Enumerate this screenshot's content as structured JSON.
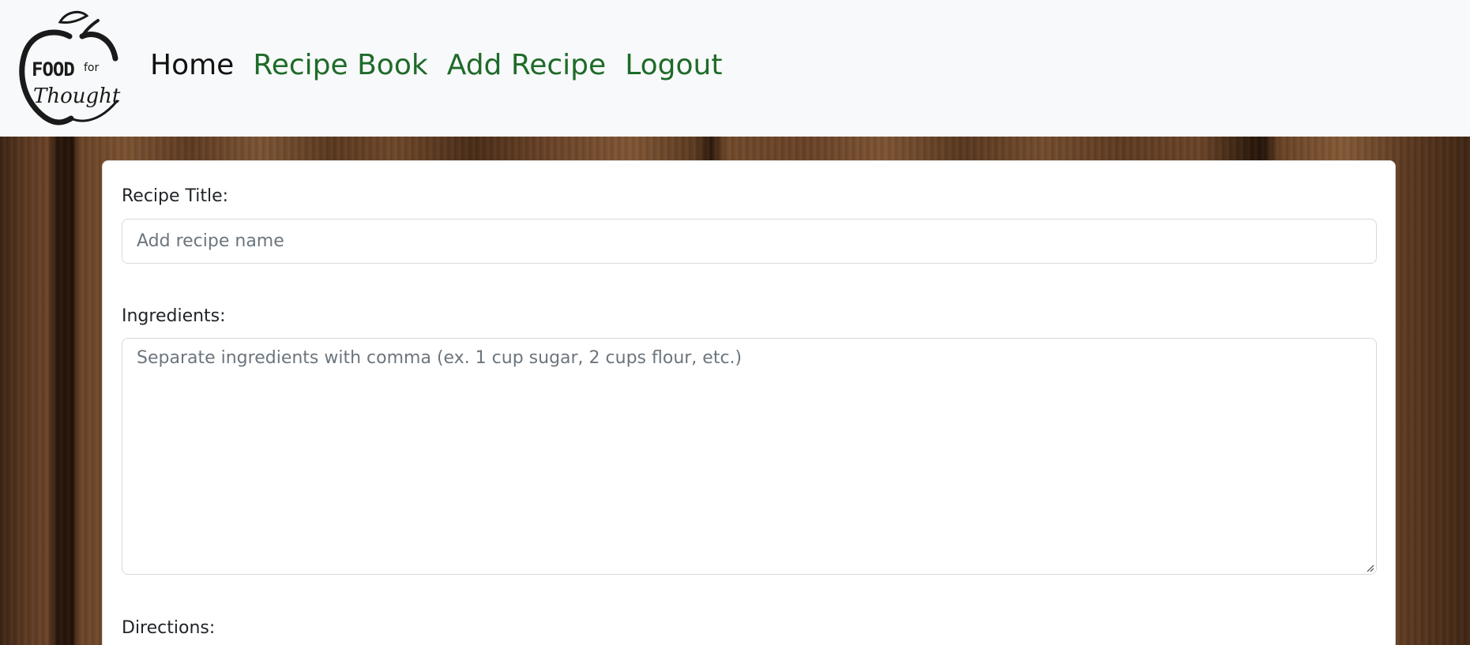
{
  "navbar": {
    "logo": {
      "line1": "FOOD",
      "line2": "for",
      "line3": "Thought"
    },
    "links": [
      {
        "label": "Home",
        "active": true
      },
      {
        "label": "Recipe Book",
        "active": false
      },
      {
        "label": "Add Recipe",
        "active": false
      },
      {
        "label": "Logout",
        "active": false
      }
    ]
  },
  "form": {
    "title_label": "Recipe Title:",
    "title_placeholder": "Add recipe name",
    "title_value": "",
    "ingredients_label": "Ingredients:",
    "ingredients_placeholder": "Separate ingredients with comma (ex. 1 cup sugar, 2 cups flour, etc.)",
    "ingredients_value": "",
    "directions_label": "Directions:"
  },
  "colors": {
    "navbar_bg": "#f8f9fa",
    "link_green": "#1e6b2a",
    "link_active": "#111111"
  },
  "icons": {
    "logo": "apple-logo-icon",
    "resize": "resize-grip-icon"
  }
}
